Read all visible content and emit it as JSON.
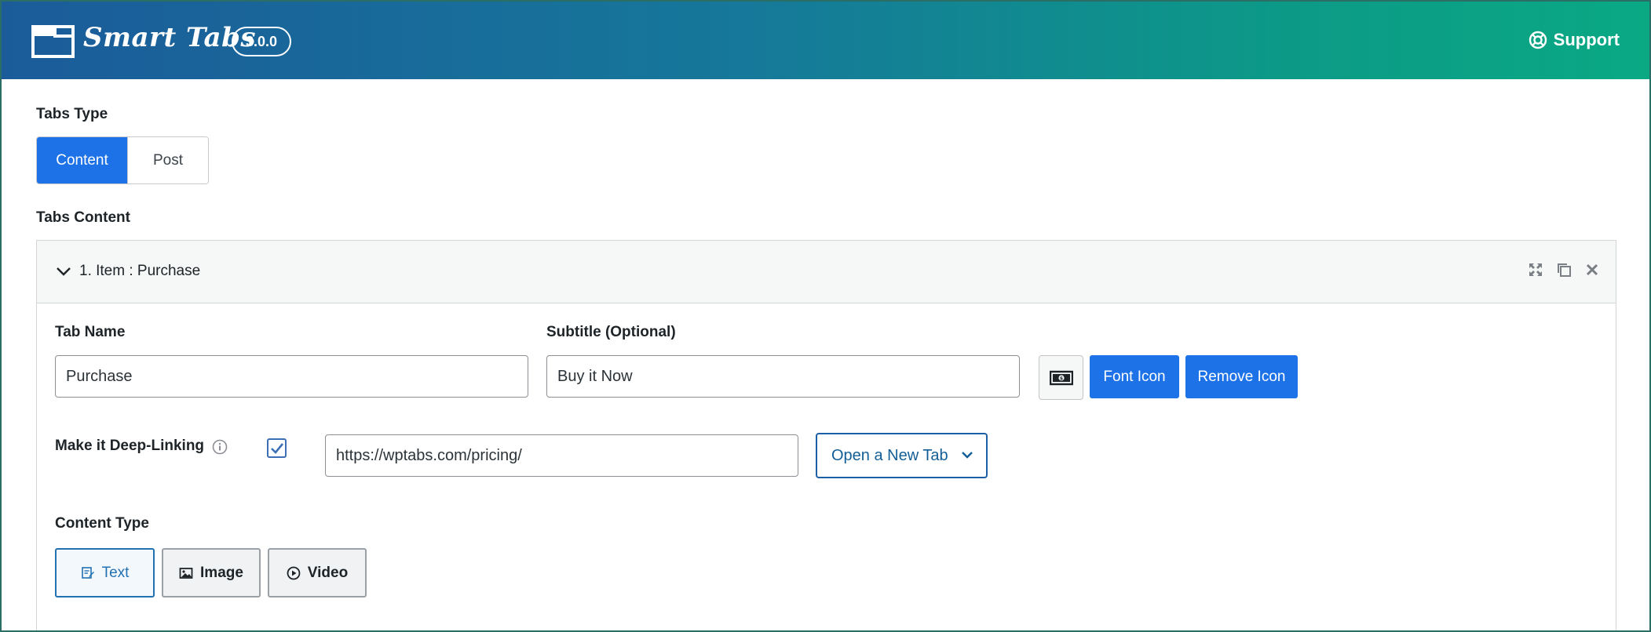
{
  "header": {
    "brand": "Smart Tabs",
    "version": "3.0.0",
    "support_label": "Support"
  },
  "tabs_type": {
    "label": "Tabs Type",
    "options": [
      "Content",
      "Post"
    ],
    "selected": "Content"
  },
  "tabs_content": {
    "label": "Tabs Content",
    "item": {
      "title": "1. Item : Purchase",
      "tab_name_label": "Tab Name",
      "tab_name_value": "Purchase",
      "subtitle_label": "Subtitle (Optional)",
      "subtitle_value": "Buy it Now",
      "font_icon_label": "Font Icon",
      "remove_icon_label": "Remove Icon",
      "deep_link_label": "Make it Deep-Linking",
      "deep_link_checked": true,
      "deep_link_url": "https://wptabs.com/pricing/",
      "link_target": "Open a New Tab",
      "content_type_label": "Content Type",
      "content_types": [
        "Text",
        "Image",
        "Video"
      ],
      "content_type_selected": "Text"
    }
  },
  "colors": {
    "accent": "#1d72e8",
    "header_start": "#1b5b9a",
    "header_end": "#0aa984"
  }
}
